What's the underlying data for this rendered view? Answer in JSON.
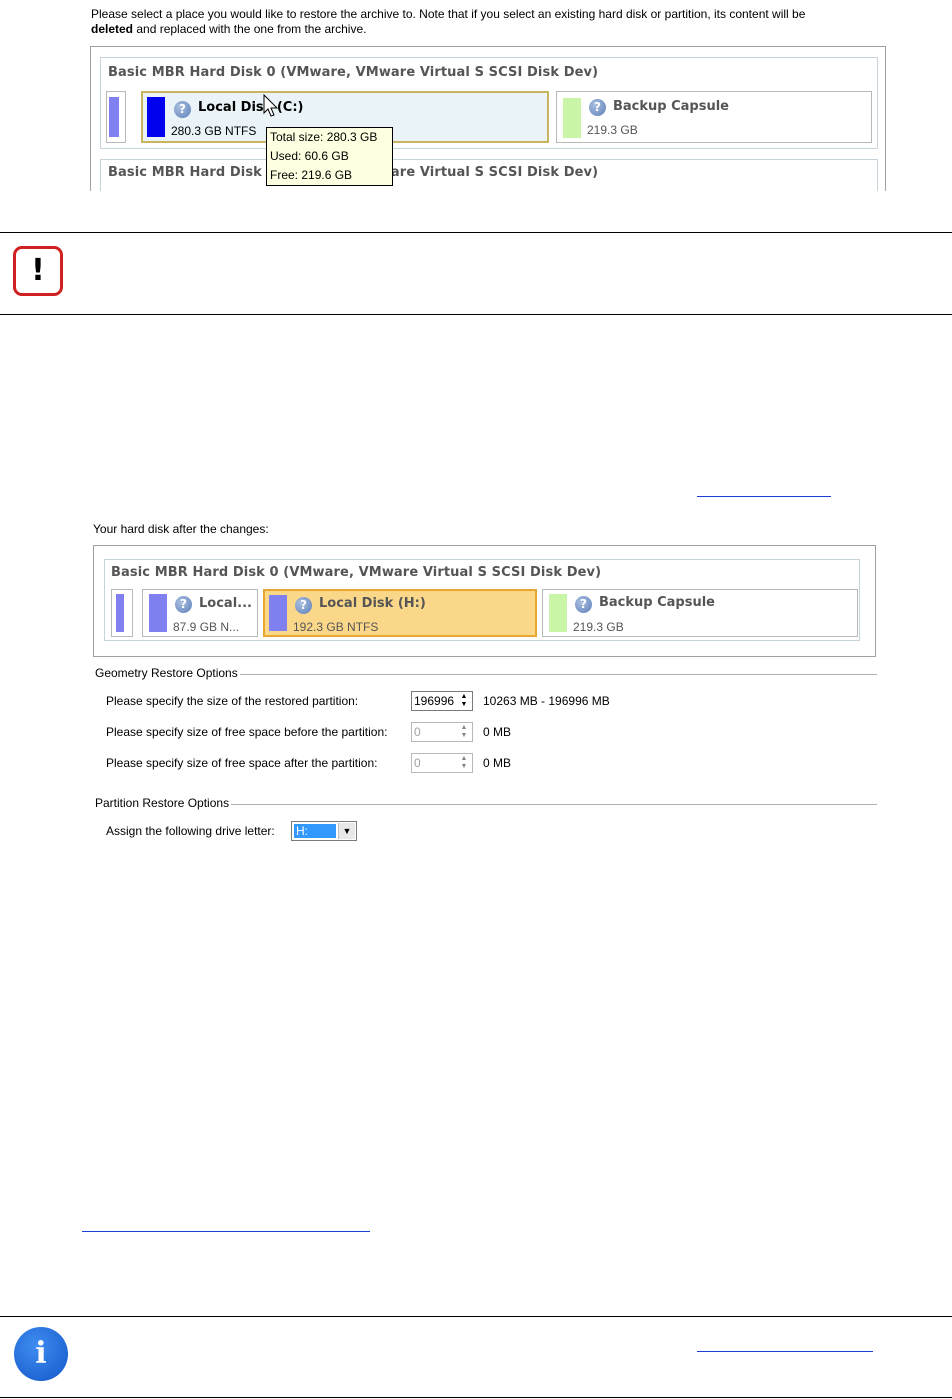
{
  "screenshot1": {
    "intro_text": "Please select a place you would like to restore the archive to. Note that if you select an existing hard disk or partition, its content will be",
    "intro_bold": "deleted",
    "intro_rest": " and replaced with the one from the archive.",
    "disk0_title": "Basic MBR Hard Disk 0 (VMware, VMware Virtual S SCSI Disk Dev)",
    "local_disk_name": "Local Disk (C:)",
    "local_disk_size": "280.3 GB NTFS",
    "backup_capsule_name": "Backup Capsule",
    "backup_capsule_size": "219.3 GB",
    "tooltip": {
      "total": "Total size: 280.3 GB",
      "used": "Used: 60.6 GB",
      "free": "Free: 219.6 GB"
    },
    "disk1_title": "Basic MBR Hard Disk 1 (VMware, VMware Virtual S SCSI Disk Dev)"
  },
  "warning": {
    "icon_glyph": "!"
  },
  "screenshot2": {
    "caption": "Your hard disk after the changes:",
    "disk0_title": "Basic MBR Hard Disk 0 (VMware, VMware Virtual S SCSI Disk Dev)",
    "tile1_name": "Local...",
    "tile1_size": "87.9 GB N...",
    "tile2_name": "Local Disk (H:)",
    "tile2_size": "192.3 GB NTFS",
    "tile3_name": "Backup Capsule",
    "tile3_size": "219.3 GB",
    "geometry_group": "Geometry Restore Options",
    "opt_size_label": "Please specify the size of the restored partition:",
    "opt_size_value": "196996",
    "opt_size_range": "10263 MB - 196996 MB",
    "opt_before_label": "Please specify size of free space before the partition:",
    "opt_before_value": "0",
    "opt_before_unit": "0 MB",
    "opt_after_label": "Please specify size of free space after the partition:",
    "opt_after_value": "0",
    "opt_after_unit": "0 MB",
    "partition_group": "Partition Restore Options",
    "drive_letter_label": "Assign the following drive letter:",
    "drive_letter_value": "H:"
  },
  "info": {
    "icon_glyph": "i"
  },
  "colors": {
    "c_drive_bar": "#0000ee",
    "backup_bar": "#c8f5a8",
    "small_bar": "#8080f0",
    "selected_tile": "#fbd78a",
    "warning_red": "#d02020",
    "info_blue": "#1a6fe0",
    "link_blue": "#1a3fd6"
  }
}
